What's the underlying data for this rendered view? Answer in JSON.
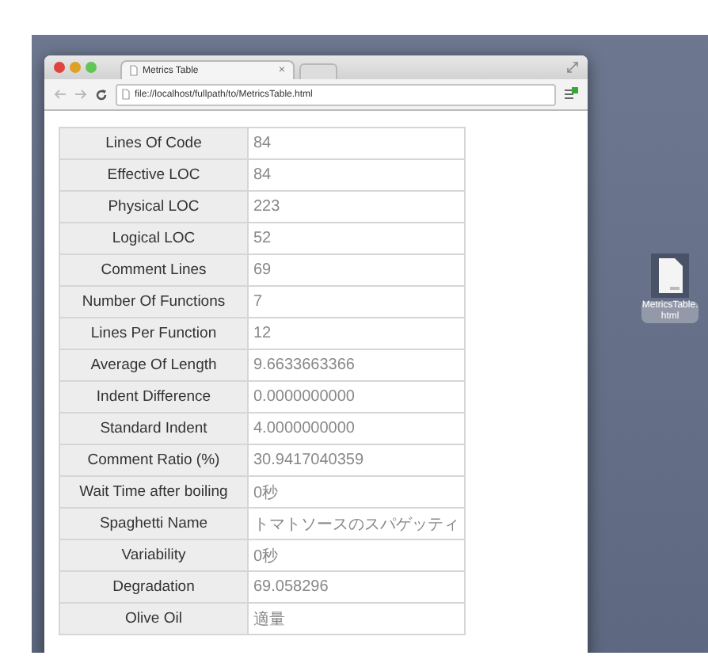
{
  "browser": {
    "tab": {
      "title": "Metrics Table",
      "close": "×"
    },
    "address": "file://localhost/fullpath/to/MetricsTable.html"
  },
  "table": {
    "rows": [
      {
        "label": "Lines Of Code",
        "value": "84"
      },
      {
        "label": "Effective LOC",
        "value": "84"
      },
      {
        "label": "Physical LOC",
        "value": "223"
      },
      {
        "label": "Logical LOC",
        "value": "52"
      },
      {
        "label": "Comment Lines",
        "value": "69"
      },
      {
        "label": "Number Of Functions",
        "value": "7"
      },
      {
        "label": "Lines Per Function",
        "value": "12"
      },
      {
        "label": "Average Of Length",
        "value": "9.6633663366"
      },
      {
        "label": "Indent Difference",
        "value": "0.0000000000"
      },
      {
        "label": "Standard Indent",
        "value": "4.0000000000"
      },
      {
        "label": "Comment Ratio (%)",
        "value": "30.9417040359"
      },
      {
        "label": "Wait Time after boiling",
        "value": "0秒"
      },
      {
        "label": "Spaghetti Name",
        "value": "トマトソースのスパゲッティ"
      },
      {
        "label": "Variability",
        "value": "0秒"
      },
      {
        "label": "Degradation",
        "value": "69.058296"
      },
      {
        "label": "Olive Oil",
        "value": "適量"
      }
    ]
  },
  "desktop_icon": {
    "label": "MetricsTable.html"
  }
}
